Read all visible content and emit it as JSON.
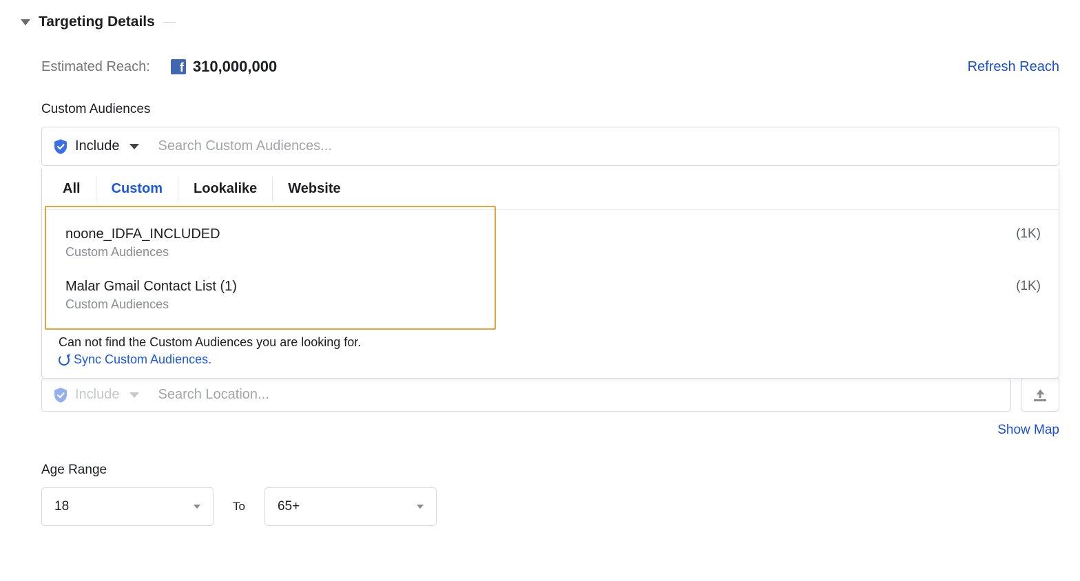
{
  "section": {
    "title": "Targeting Details"
  },
  "reach": {
    "label": "Estimated Reach:",
    "value": "310,000,000",
    "refresh_link": "Refresh Reach"
  },
  "custom_audiences": {
    "label": "Custom Audiences",
    "include_label": "Include",
    "search_placeholder": "Search Custom Audiences...",
    "tabs": {
      "all": "All",
      "custom": "Custom",
      "lookalike": "Lookalike",
      "website": "Website"
    },
    "items": [
      {
        "name": "noone_IDFA_INCLUDED",
        "type": "Custom Audiences",
        "count": "(1K)"
      },
      {
        "name": "Malar Gmail Contact List (1)",
        "type": "Custom Audiences",
        "count": "(1K)"
      }
    ],
    "cannot_find": "Can not find the Custom Audiences you are looking for.",
    "sync_link": "Sync Custom Audiences."
  },
  "location": {
    "include_label": "Include",
    "search_placeholder": "Search Location...",
    "show_map": "Show Map"
  },
  "age": {
    "label": "Age Range",
    "from": "18",
    "to_label": "To",
    "to": "65+"
  }
}
